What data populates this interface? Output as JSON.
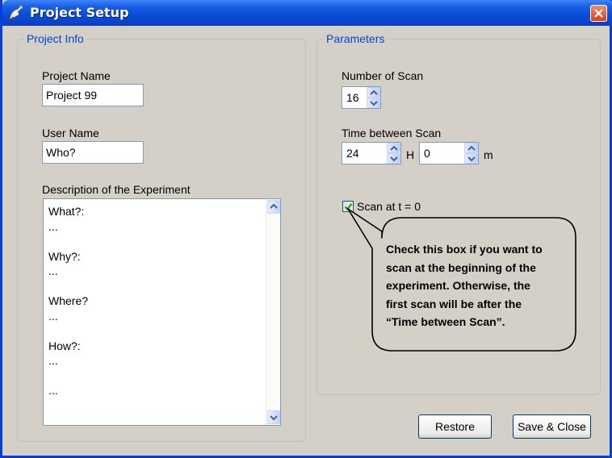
{
  "window": {
    "title": "Project Setup",
    "icon": "satellite-dish-icon"
  },
  "project_info": {
    "legend": "Project Info",
    "project_name_label": "Project Name",
    "project_name_value": "Project 99",
    "user_name_label": "User Name",
    "user_name_value": "Who?",
    "description_label": "Description of the Experiment",
    "description_value": "What?:\n...\n\nWhy?:\n...\n\nWhere?\n...\n\nHow?:\n...\n\n..."
  },
  "parameters": {
    "legend": "Parameters",
    "number_of_scan_label": "Number of Scan",
    "number_of_scan_value": "16",
    "time_between_scan_label": "Time between Scan",
    "hours_value": "24",
    "hours_unit": "H",
    "minutes_value": "0",
    "minutes_unit": "m",
    "scan_at_zero_label": "Scan at t = 0",
    "scan_at_zero_checked": true
  },
  "callout": {
    "text": "Check this box if you want to\nscan at the beginning of the\nexperiment. Otherwise, the\nfirst scan will be after the\n“Time between Scan”."
  },
  "buttons": {
    "restore_label": "Restore",
    "save_close_label": "Save & Close"
  },
  "colors": {
    "title_bar": "#0a4bd6",
    "legend_text": "#0046d5",
    "close_button": "#d9401c",
    "check_mark": "#21a121"
  }
}
